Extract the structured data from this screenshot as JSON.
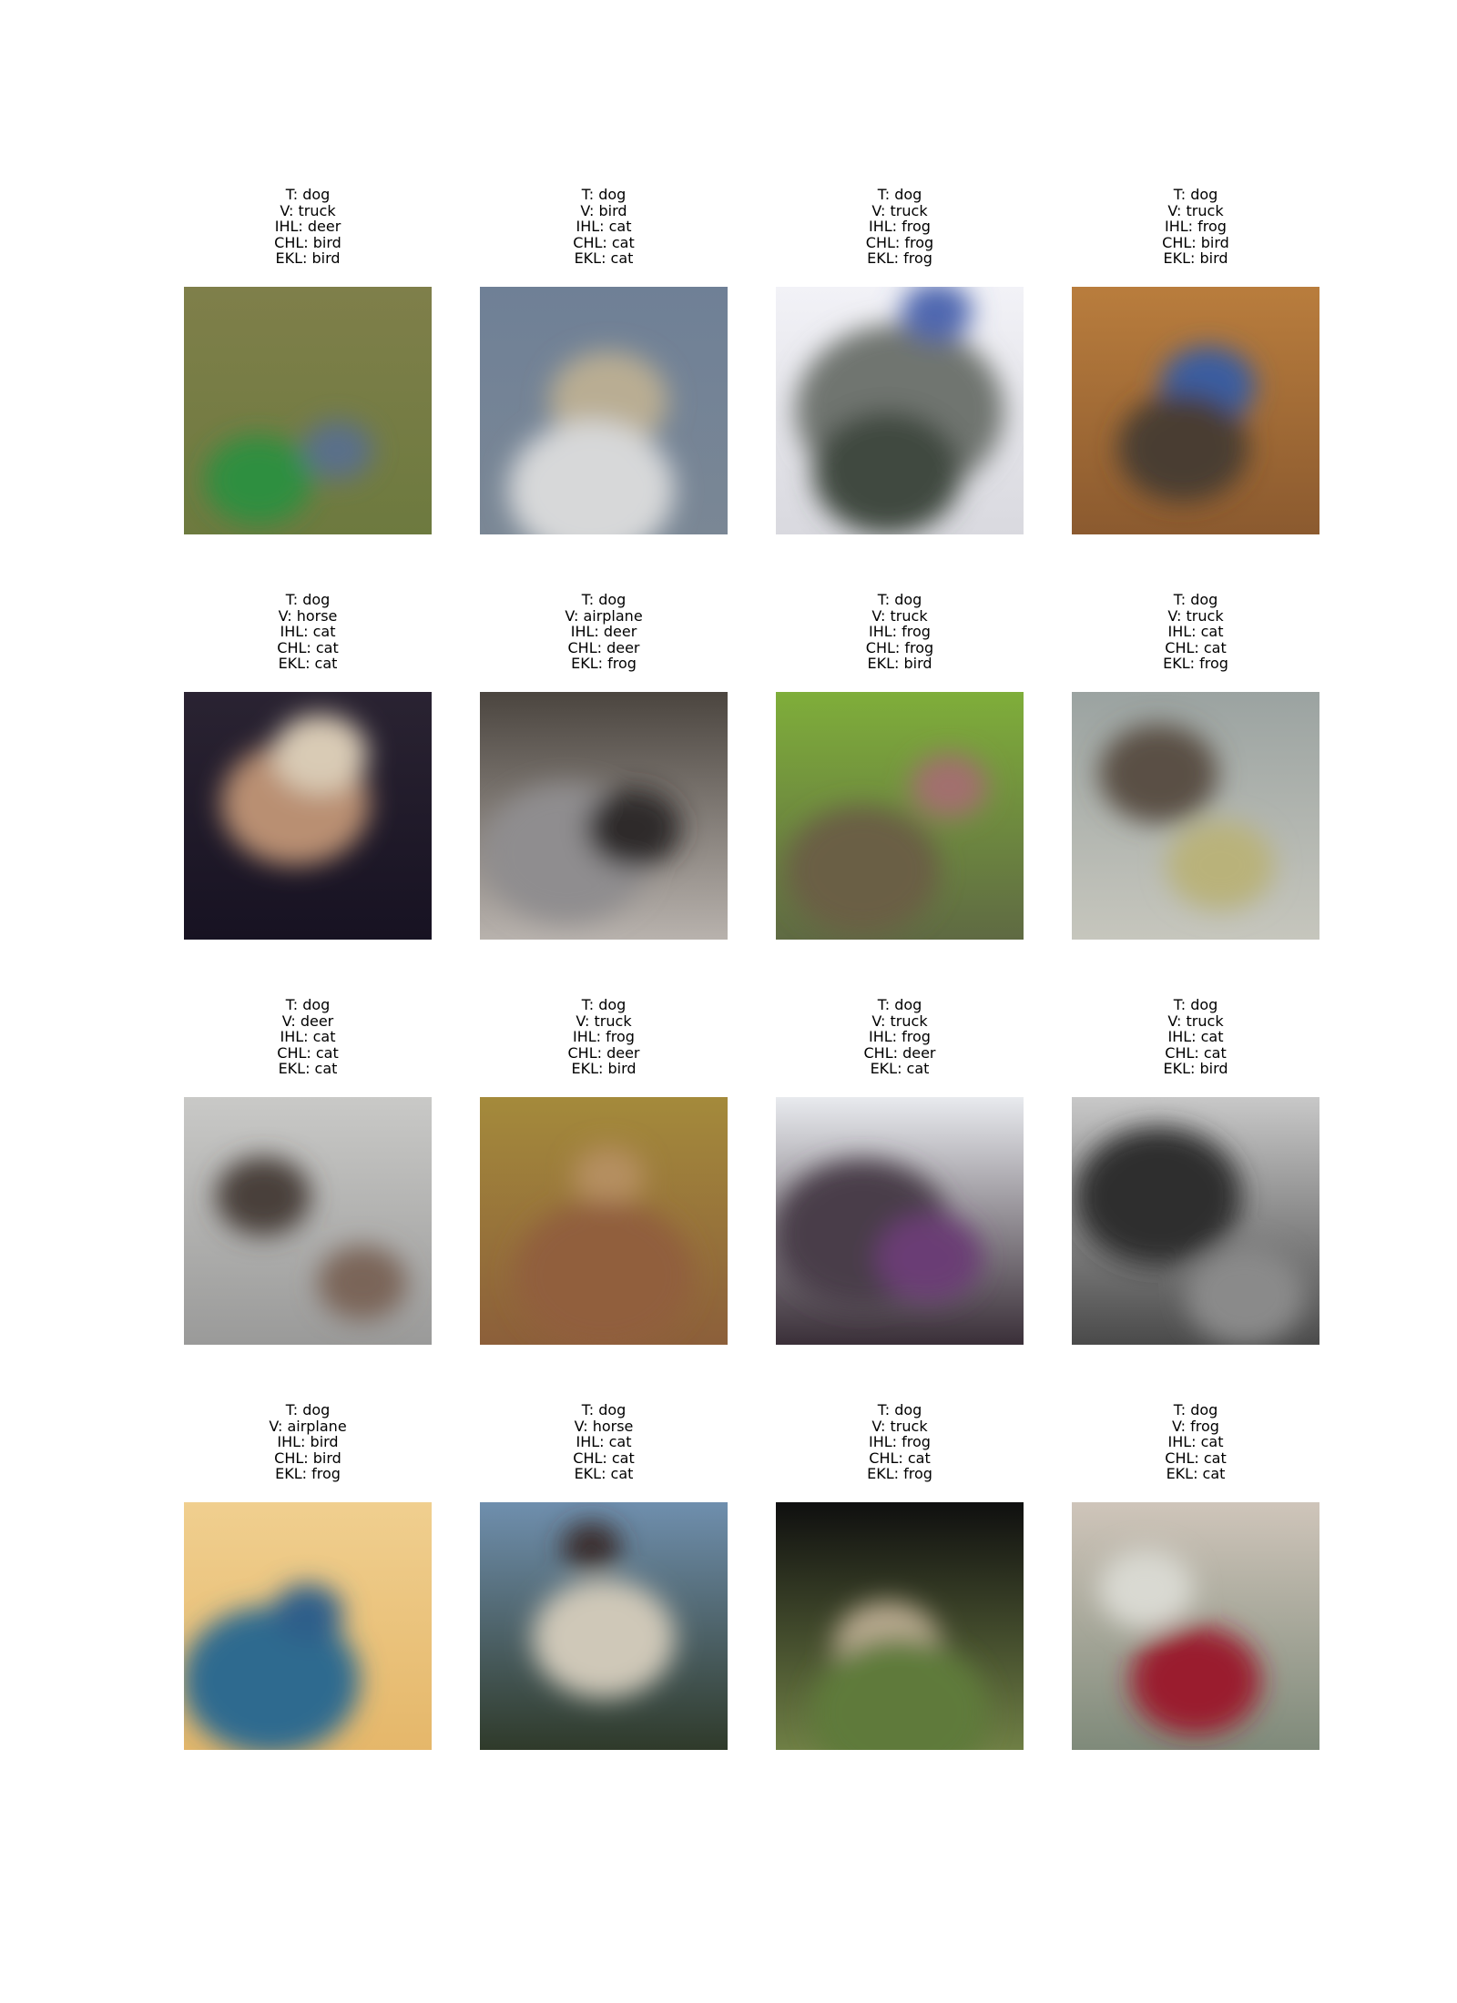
{
  "grid": {
    "cells": [
      {
        "lines": [
          "T: dog",
          "V: truck",
          "IHL: deer",
          "CHL: bird",
          "EKL: bird"
        ],
        "image": {
          "kind": "blob",
          "bg": [
            "#7f7f4a",
            "#6d7a3f"
          ],
          "blobs": [
            [
              "#2f8f3f",
              0.3,
              0.78,
              0.18
            ],
            [
              "#5a6f8a",
              0.62,
              0.66,
              0.12
            ]
          ]
        }
      },
      {
        "lines": [
          "T: dog",
          "V: bird",
          "IHL: cat",
          "CHL: cat",
          "EKL: cat"
        ],
        "image": {
          "kind": "blob",
          "bg": [
            "#6f8096",
            "#7a8795"
          ],
          "blobs": [
            [
              "#b9ad93",
              0.52,
              0.46,
              0.2
            ],
            [
              "#d7d8d9",
              0.45,
              0.82,
              0.28
            ]
          ]
        }
      },
      {
        "lines": [
          "T: dog",
          "V: truck",
          "IHL: frog",
          "CHL: frog",
          "EKL: frog"
        ],
        "image": {
          "kind": "blob",
          "bg": [
            "#f2f2f7",
            "#d9d9df"
          ],
          "blobs": [
            [
              "#6f7470",
              0.5,
              0.5,
              0.35
            ],
            [
              "#3f4a3f",
              0.45,
              0.75,
              0.25
            ],
            [
              "#4f68b0",
              0.65,
              0.1,
              0.12
            ]
          ]
        }
      },
      {
        "lines": [
          "T: dog",
          "V: truck",
          "IHL: frog",
          "CHL: bird",
          "EKL: bird"
        ],
        "image": {
          "kind": "blob",
          "bg": [
            "#b97d3d",
            "#8b5a2f"
          ],
          "blobs": [
            [
              "#3b5da0",
              0.55,
              0.4,
              0.16
            ],
            [
              "#4a3d33",
              0.45,
              0.65,
              0.22
            ]
          ]
        }
      },
      {
        "lines": [
          "T: dog",
          "V: horse",
          "IHL: cat",
          "CHL: cat",
          "EKL: cat"
        ],
        "image": {
          "kind": "blob",
          "bg": [
            "#2a2332",
            "#171222"
          ],
          "blobs": [
            [
              "#b98f72",
              0.45,
              0.45,
              0.25
            ],
            [
              "#d9cbb5",
              0.55,
              0.25,
              0.16
            ]
          ]
        }
      },
      {
        "lines": [
          "T: dog",
          "V: airplane",
          "IHL: deer",
          "CHL: deer",
          "EKL: frog"
        ],
        "image": {
          "kind": "blob",
          "bg": [
            "#4b453f",
            "#b8b2ad"
          ],
          "blobs": [
            [
              "#8f8d8f",
              0.35,
              0.65,
              0.28
            ],
            [
              "#2f2a2a",
              0.62,
              0.55,
              0.16
            ]
          ]
        }
      },
      {
        "lines": [
          "T: dog",
          "V: truck",
          "IHL: frog",
          "CHL: frog",
          "EKL: bird"
        ],
        "image": {
          "kind": "blob",
          "bg": [
            "#7fae3a",
            "#5f6a43"
          ],
          "blobs": [
            [
              "#a26f6e",
              0.7,
              0.38,
              0.13
            ],
            [
              "#6b5f45",
              0.35,
              0.72,
              0.26
            ]
          ]
        }
      },
      {
        "lines": [
          "T: dog",
          "V: truck",
          "IHL: cat",
          "CHL: cat",
          "EKL: frog"
        ],
        "image": {
          "kind": "blob",
          "bg": [
            "#9ba3a1",
            "#c6c6bd"
          ],
          "blobs": [
            [
              "#5a4f45",
              0.35,
              0.33,
              0.2
            ],
            [
              "#b9b27a",
              0.6,
              0.7,
              0.18
            ]
          ]
        }
      },
      {
        "lines": [
          "T: dog",
          "V: deer",
          "IHL: cat",
          "CHL: cat",
          "EKL: cat"
        ],
        "image": {
          "kind": "blob",
          "bg": [
            "#c9c9c7",
            "#9a9a99"
          ],
          "blobs": [
            [
              "#4a3f3a",
              0.32,
              0.4,
              0.16
            ],
            [
              "#7a6558",
              0.72,
              0.75,
              0.15
            ]
          ]
        }
      },
      {
        "lines": [
          "T: dog",
          "V: truck",
          "IHL: frog",
          "CHL: deer",
          "EKL: bird"
        ],
        "image": {
          "kind": "blob",
          "bg": [
            "#a48a3b",
            "#8c5f3a"
          ],
          "blobs": [
            [
              "#b58f61",
              0.52,
              0.32,
              0.12
            ],
            [
              "#915f3e",
              0.5,
              0.72,
              0.3
            ]
          ]
        }
      },
      {
        "lines": [
          "T: dog",
          "V: truck",
          "IHL: frog",
          "CHL: deer",
          "EKL: cat"
        ],
        "image": {
          "kind": "blob",
          "bg": [
            "#e8eaee",
            "#3a2f38"
          ],
          "blobs": [
            [
              "#4a3d4a",
              0.35,
              0.55,
              0.3
            ],
            [
              "#6a3d75",
              0.62,
              0.65,
              0.18
            ]
          ]
        }
      },
      {
        "lines": [
          "T: dog",
          "V: truck",
          "IHL: cat",
          "CHL: cat",
          "EKL: bird"
        ],
        "image": {
          "kind": "blob",
          "bg": [
            "#c8c8c8",
            "#4a4a4a"
          ],
          "blobs": [
            [
              "#2f2f2f",
              0.35,
              0.4,
              0.28
            ],
            [
              "#8a8a8a",
              0.7,
              0.8,
              0.2
            ]
          ]
        }
      },
      {
        "lines": [
          "T: dog",
          "V: airplane",
          "IHL: bird",
          "CHL: bird",
          "EKL: frog"
        ],
        "image": {
          "kind": "blob",
          "bg": [
            "#f0cf8f",
            "#e5b76a"
          ],
          "blobs": [
            [
              "#2f6a8f",
              0.35,
              0.72,
              0.3
            ],
            [
              "#2f5f8a",
              0.5,
              0.45,
              0.12
            ]
          ]
        }
      },
      {
        "lines": [
          "T: dog",
          "V: horse",
          "IHL: cat",
          "CHL: cat",
          "EKL: cat"
        ],
        "image": {
          "kind": "blob",
          "bg": [
            "#6f8fae",
            "#2f3a2a"
          ],
          "blobs": [
            [
              "#cfc8b8",
              0.5,
              0.55,
              0.24
            ],
            [
              "#3a2f2f",
              0.45,
              0.18,
              0.1
            ]
          ]
        }
      },
      {
        "lines": [
          "T: dog",
          "V: truck",
          "IHL: frog",
          "CHL: cat",
          "EKL: frog"
        ],
        "image": {
          "kind": "blob",
          "bg": [
            "#0f0f0f",
            "#6f7f45"
          ],
          "blobs": [
            [
              "#b8a98f",
              0.45,
              0.58,
              0.18
            ],
            [
              "#5f7a3a",
              0.5,
              0.85,
              0.3
            ]
          ]
        }
      },
      {
        "lines": [
          "T: dog",
          "V: frog",
          "IHL: cat",
          "CHL: cat",
          "EKL: cat"
        ],
        "image": {
          "kind": "blob",
          "bg": [
            "#cfc5ba",
            "#7f8a7a"
          ],
          "blobs": [
            [
              "#9a1f2f",
              0.5,
              0.72,
              0.22
            ],
            [
              "#d9d9d2",
              0.3,
              0.35,
              0.16
            ]
          ]
        }
      }
    ]
  }
}
